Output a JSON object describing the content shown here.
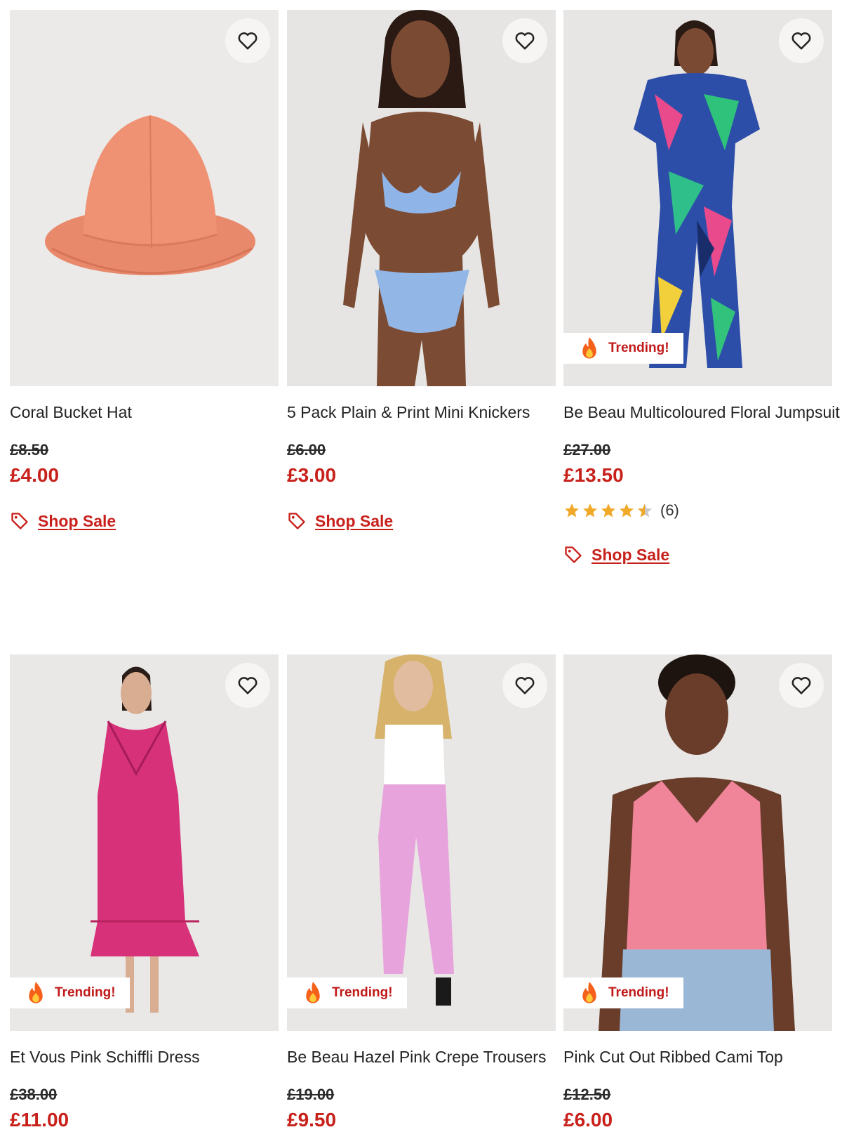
{
  "colors": {
    "sale": "#c8211b",
    "trending": "#c01a1a",
    "star": "#f0a928"
  },
  "products": [
    {
      "title": "Coral Bucket Hat",
      "was": "£8.50",
      "now": "£4.00",
      "shop_label": "Shop Sale",
      "image": "coral-bucket-hat-photo"
    },
    {
      "title": "5 Pack Plain & Print Mini Knickers",
      "was": "£6.00",
      "now": "£3.00",
      "shop_label": "Shop Sale",
      "image": "blue-bikini-model-photo"
    },
    {
      "title": "Be Beau Multicoloured Floral Jumpsuit",
      "was": "£27.00",
      "now": "£13.50",
      "badge": "Trending!",
      "rating": 4.5,
      "review_count": "(6)",
      "shop_label": "Shop Sale",
      "image": "floral-jumpsuit-model-photo"
    },
    {
      "title": "Et Vous Pink Schiffli Dress",
      "was": "£38.00",
      "now": "£11.00",
      "badge": "Trending!",
      "image": "pink-schiffli-dress-model-photo"
    },
    {
      "title": "Be Beau Hazel Pink Crepe Trousers",
      "was": "£19.00",
      "now": "£9.50",
      "badge": "Trending!",
      "image": "pink-trousers-model-photo"
    },
    {
      "title": "Pink Cut Out Ribbed Cami Top",
      "was": "£12.50",
      "now": "£6.00",
      "badge": "Trending!",
      "image": "pink-cami-top-model-photo"
    }
  ]
}
